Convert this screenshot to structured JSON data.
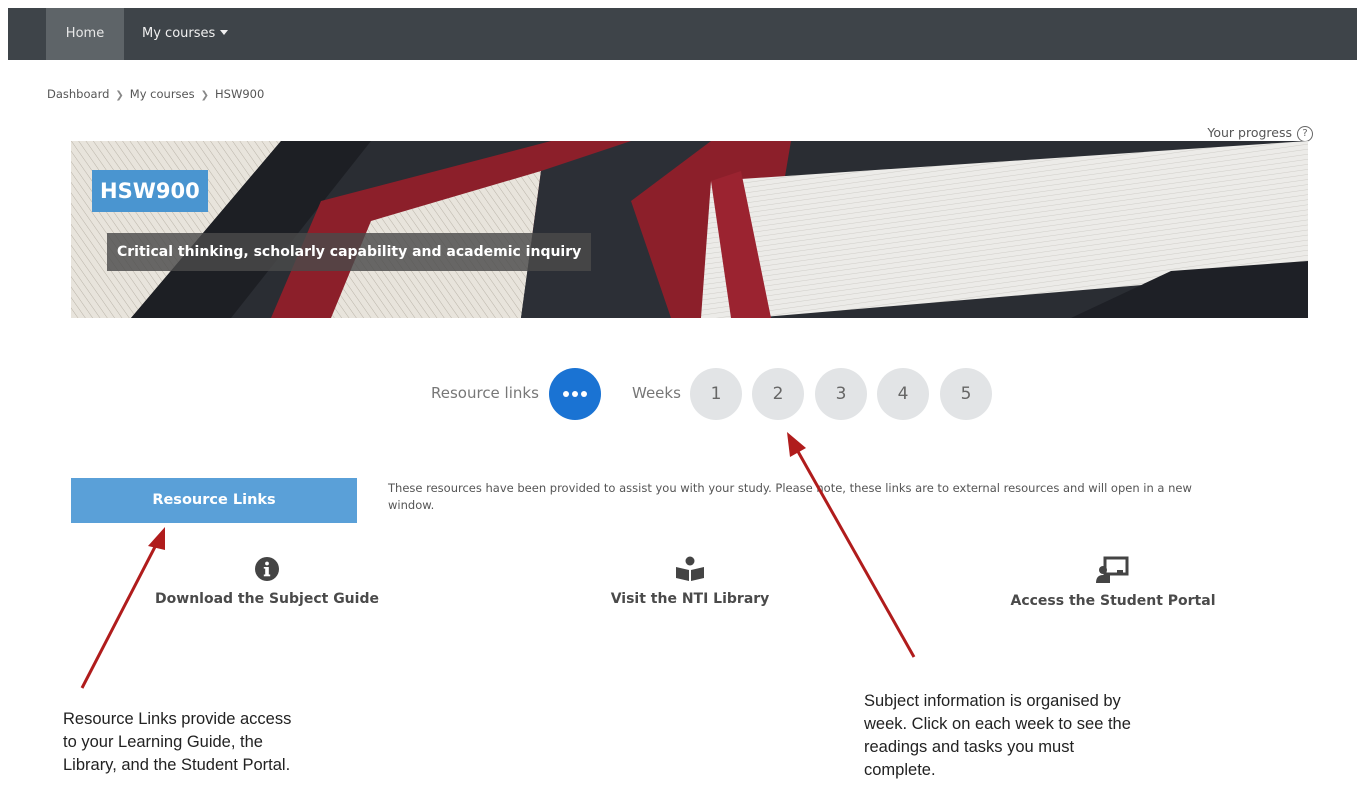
{
  "navbar": {
    "home_label": "Home",
    "courses_label": "My courses"
  },
  "breadcrumb": {
    "items": [
      "Dashboard",
      "My courses",
      "HSW900"
    ]
  },
  "progress": {
    "label": "Your progress",
    "icon": "help-circle-icon"
  },
  "course": {
    "code": "HSW900",
    "title": "Critical thinking, scholarly capability and academic inquiry"
  },
  "tabs": {
    "resource_label": "Resource links",
    "weeks_label": "Weeks",
    "weeks": [
      "1",
      "2",
      "3",
      "4",
      "5"
    ],
    "accent": "#1a73d3"
  },
  "resources": {
    "button_label": "Resource Links",
    "description": "These resources have been provided to assist you with your study. Please note, these links are to external resources and will open in a new window.",
    "links": [
      {
        "label": "Download the Subject Guide",
        "icon": "info-icon"
      },
      {
        "label": "Visit the NTI Library",
        "icon": "book-reader-icon"
      },
      {
        "label": "Access the Student Portal",
        "icon": "presentation-icon"
      }
    ]
  },
  "annotations": {
    "left": [
      "Resource Links provide access",
      "to your Learning Guide, the",
      "Library, and the Student Portal."
    ],
    "right": [
      "Subject information is organised by",
      "week. Click on each week to see the",
      "readings and tasks you must",
      "complete."
    ],
    "arrow_color": "#b01c1c"
  }
}
